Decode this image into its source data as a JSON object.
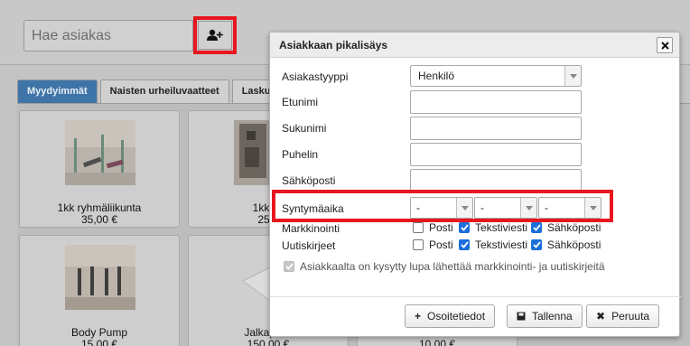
{
  "background": {
    "search": {
      "placeholder": "Hae asiakas"
    },
    "add_customer_icon": "user-plus-icon",
    "tabs": [
      {
        "label": "Myydyimmät",
        "active": true
      },
      {
        "label": "Naisten urheiluvaatteet",
        "active": false
      },
      {
        "label": "Laskut",
        "active": false
      }
    ],
    "products": [
      {
        "name": "1kk ryhmäliikunta",
        "price": "35,00 €"
      },
      {
        "name": "1kk ku",
        "price": "25,0"
      },
      {
        "name": "Body Pump",
        "price": "15,00 €"
      },
      {
        "name": "Jalkapallo",
        "price": "150,00 €"
      },
      {
        "name": "",
        "price": "10,00 €"
      }
    ]
  },
  "modal": {
    "title": "Asiakkaan pikalisäys",
    "close_icon": "close-icon",
    "fields": {
      "customer_type": {
        "label": "Asiakastyyppi",
        "value": "Henkilö"
      },
      "first_name": {
        "label": "Etunimi",
        "value": ""
      },
      "last_name": {
        "label": "Sukunimi",
        "value": ""
      },
      "phone": {
        "label": "Puhelin",
        "value": ""
      },
      "email": {
        "label": "Sähköposti",
        "value": ""
      },
      "birthdate": {
        "label": "Syntymäaika",
        "day": "-",
        "month": "-",
        "year": "-"
      }
    },
    "marketing": {
      "label": "Markkinointi",
      "options": [
        {
          "label": "Posti",
          "checked": false
        },
        {
          "label": "Tekstiviesti",
          "checked": true
        },
        {
          "label": "Sähköposti",
          "checked": true
        }
      ]
    },
    "newsletters": {
      "label": "Uutiskirjeet",
      "options": [
        {
          "label": "Posti",
          "checked": false
        },
        {
          "label": "Tekstiviesti",
          "checked": true
        },
        {
          "label": "Sähköposti",
          "checked": true
        }
      ]
    },
    "consent": {
      "label": "Asiakkaalta on kysytty lupa lähettää markkinointi- ja uutiskirjeitä",
      "checked": true
    },
    "buttons": {
      "address": "Osoitetiedot",
      "save": "Tallenna",
      "cancel": "Peruuta"
    }
  },
  "colors": {
    "highlight": "#e8161f",
    "tab_active": "#3f74a8",
    "checkbox": "#1a6fd8"
  }
}
